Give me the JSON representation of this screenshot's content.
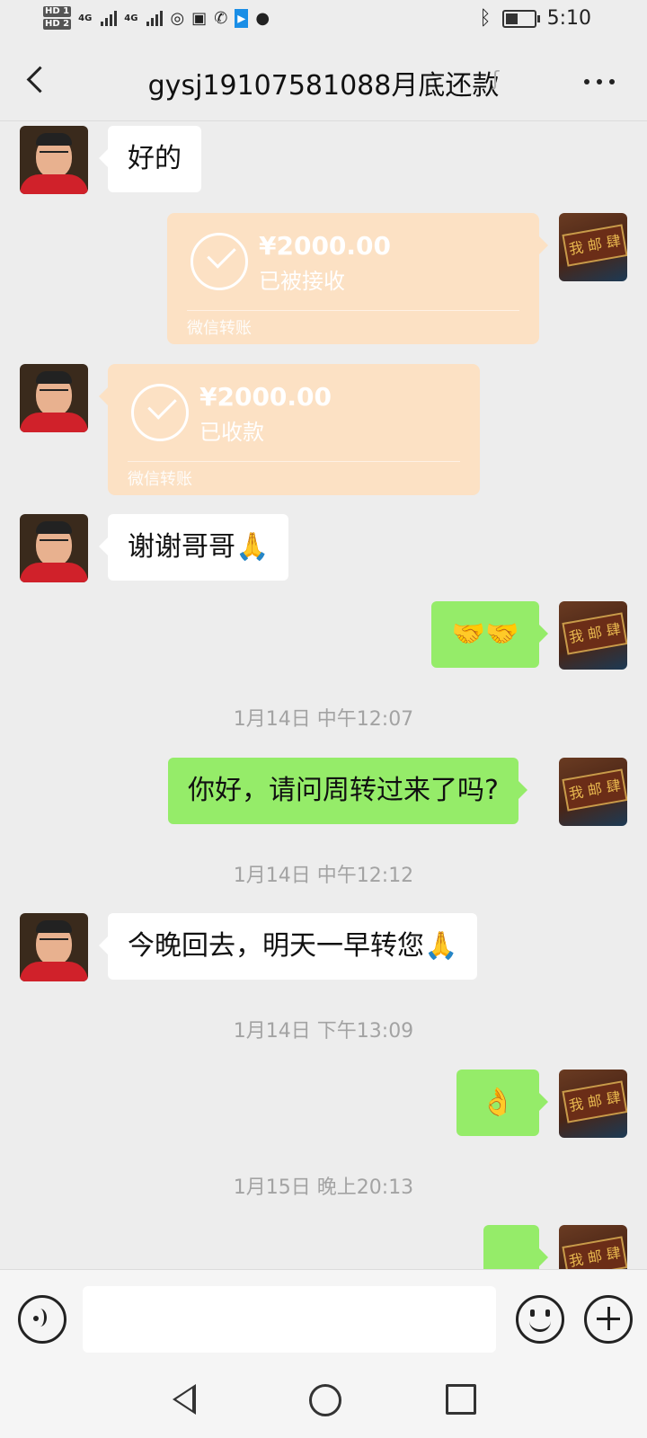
{
  "status_bar": {
    "network_a": "4G",
    "network_b": "4G",
    "time": "5:10",
    "battery_level": 0.5
  },
  "header": {
    "title": "gysj19107581088月底还款",
    "back_icon": "chevron-left-icon",
    "ear_icon": "ear-icon",
    "more_icon": "more-dots-icon"
  },
  "messages": [
    {
      "side": "left",
      "type": "text",
      "text": "好的"
    },
    {
      "side": "right",
      "type": "transfer",
      "amount": "¥2000.00",
      "status": "已被接收",
      "label": "微信转账"
    },
    {
      "side": "left",
      "type": "transfer",
      "amount": "¥2000.00",
      "status": "已收款",
      "label": "微信转账"
    },
    {
      "side": "left",
      "type": "text",
      "text": "谢谢哥哥🙏"
    },
    {
      "side": "right",
      "type": "text",
      "text": "🤝🤝"
    },
    {
      "type": "time",
      "text": "1月14日 中午12:07"
    },
    {
      "side": "right",
      "type": "text",
      "text": "你好，请问周转过来了吗?"
    },
    {
      "type": "time",
      "text": "1月14日 中午12:12"
    },
    {
      "side": "left",
      "type": "text",
      "text": "今晚回去，明天一早转您🙏"
    },
    {
      "type": "time",
      "text": "1月14日 下午13:09"
    },
    {
      "side": "right",
      "type": "text",
      "text": "👌"
    },
    {
      "type": "time",
      "text": "1月15日 晚上20:13"
    }
  ],
  "me_avatar_sign": "我 邮 肆",
  "input_bar": {
    "voice_icon": "voice-icon",
    "text_value": "",
    "emoji_icon": "emoji-icon",
    "plus_icon": "plus-icon"
  },
  "nav_bar": {
    "back_icon": "nav-back-icon",
    "home_icon": "nav-home-icon",
    "recent_icon": "nav-recent-icon"
  },
  "colors": {
    "background": "#ededed",
    "my_bubble": "#95ec69",
    "friend_bubble": "#ffffff",
    "transfer_card": "#fce1c4"
  }
}
